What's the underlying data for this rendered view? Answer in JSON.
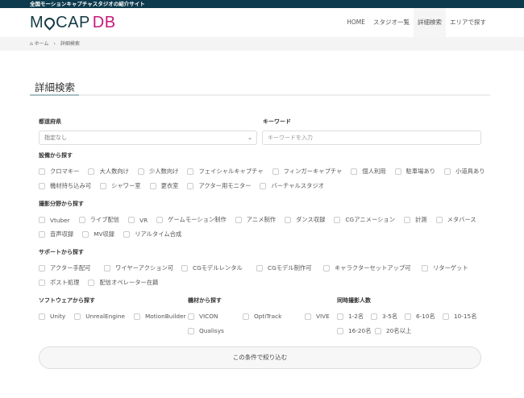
{
  "topbar": "全国モーションキャプチャスタジオの紹介サイト",
  "logo": {
    "m": "M",
    "cap": "CAP",
    "db": "DB"
  },
  "nav": [
    "HOME",
    "スタジオ一覧",
    "詳細検索",
    "エリアで探す"
  ],
  "breadcrumb": {
    "home": "ホーム",
    "sep": "›",
    "current": "詳細検索"
  },
  "title": "詳細検索",
  "prefecture": {
    "label": "都道府県",
    "value": "指定なし"
  },
  "keyword": {
    "label": "キーワード",
    "placeholder": "キーワードを入力"
  },
  "facilities": {
    "label": "設備から探す",
    "items": [
      "クロマキー",
      "大人数向け",
      "少人数向け",
      "フェイシャルキャプチャ",
      "フィンガーキャプチャ",
      "個人利用",
      "駐車場あり",
      "小道具あり",
      "機材持ち込み可",
      "シャワー室",
      "更衣室",
      "アクター用モニター",
      "バーチャルスタジオ"
    ]
  },
  "fields": {
    "label": "撮影分野から探す",
    "items": [
      "Vtuber",
      "ライブ配信",
      "VR",
      "ゲームモーション制作",
      "アニメ制作",
      "ダンス収録",
      "CGアニメーション",
      "計測",
      "メタバース",
      "音声収録",
      "MV収録",
      "リアルタイム合成"
    ]
  },
  "support": {
    "label": "サポートから探す",
    "items": [
      "アクター手配可",
      "ワイヤーアクション可",
      "CGモデルレンタル",
      "CGモデル制作可",
      "キャラクターセットアップ可",
      "リターゲット",
      "ポスト処理",
      "配信オペレーター在籍"
    ]
  },
  "software": {
    "label": "ソフトウェアから探す",
    "items": [
      "Unity",
      "UnrealEngine",
      "MotionBuilder"
    ]
  },
  "equipment": {
    "label": "機材から探す",
    "items": [
      "VICON",
      "OptiTrack",
      "VIVE",
      "Qualisys"
    ]
  },
  "people": {
    "label": "同時撮影人数",
    "items": [
      "1-2名",
      "3-5名",
      "6-10名",
      "10-15名",
      "16-20名",
      "20名以上"
    ]
  },
  "submit": "この条件で絞り込む"
}
